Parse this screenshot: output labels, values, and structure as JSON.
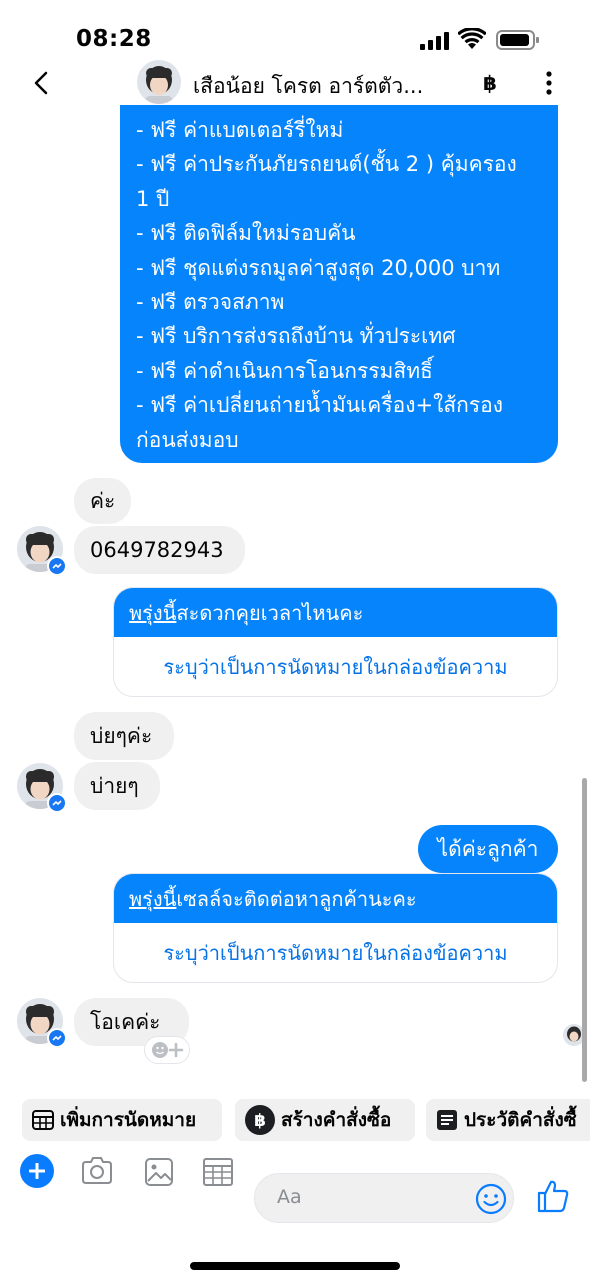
{
  "status_bar": {
    "time": "08:28"
  },
  "header": {
    "title": "เสือน้อย โครต อาร์ตตัว...",
    "baht_symbol": "฿"
  },
  "messages": {
    "outgoing_list": [
      "- ฟรี ค่าแบตเตอร์รี่ใหม่",
      "- ฟรี ค่าประกันภัยรถยนต์(ชั้น 2 ) คุ้มครอง",
      "1 ปี",
      "- ฟรี ติดฟิล์มใหม่รอบคัน",
      "- ฟรี ชุดแต่งรถมูลค่าสูงสุด 20,000 บาท",
      "- ฟรี ตรวจสภาพ",
      "- ฟรี บริการส่งรถถึงบ้าน ทั่วประเทศ",
      "- ฟรี ค่าดำเนินการโอนกรรมสิทธิ์",
      "- ฟรี ค่าเปลี่ยนถ่ายน้ำมันเครื่อง+ใส้กรอง",
      "ก่อนส่งมอบ"
    ],
    "in_1": "ค่ะ",
    "in_2": "0649782943",
    "card_1": {
      "underlined": "พรุ่งนี้",
      "rest": "สะดวกคุยเวลาไหนคะ",
      "action": "ระบุว่าเป็นการนัดหมายในกล่องข้อความ"
    },
    "in_3": "บ่ยๆค่ะ",
    "in_4": "บ่ายๆ",
    "out_small": "ได้ค่ะลูกค้า",
    "card_2": {
      "underlined": "พรุ่งนี้",
      "rest": "เซลล์จะติดต่อหาลูกค้านะคะ",
      "action": "ระบุว่าเป็นการนัดหมายในกล่องข้อความ"
    },
    "in_5": "โอเคค่ะ"
  },
  "quick_actions": [
    {
      "label": "เพิ่มการนัดหมาย",
      "icon": "calendar-grid-icon"
    },
    {
      "label": "สร้างคำสั่งซื้อ",
      "icon": "baht-circle-icon"
    },
    {
      "label": "ประวัติคำสั่งซื้",
      "icon": "receipt-icon"
    }
  ],
  "composer": {
    "placeholder": "Aa"
  },
  "colors": {
    "accent": "#0584fc",
    "incoming_bg": "#f0f0f0",
    "link": "#0572e6"
  }
}
